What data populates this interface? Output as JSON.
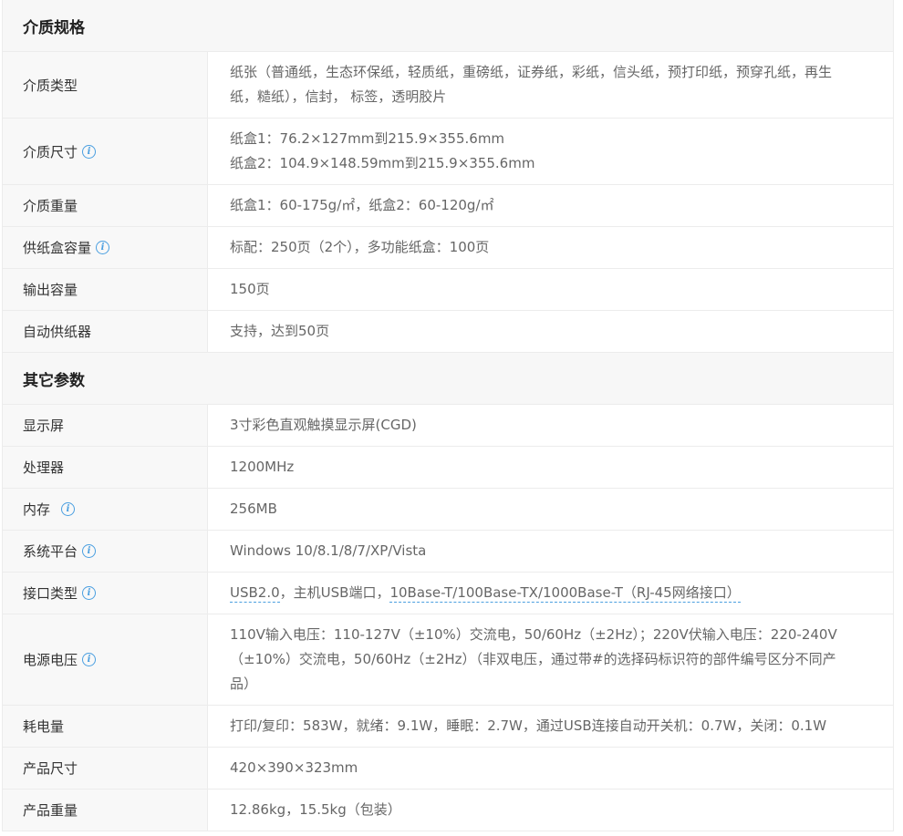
{
  "sections": [
    {
      "title": "介质规格",
      "rows": [
        {
          "label": "介质类型",
          "info": false,
          "lines": [
            "纸张（普通纸，生态环保纸，轻质纸，重磅纸，证券纸，彩纸，信头纸，预打印纸，预穿孔纸，再生",
            "纸，糙纸），信封， 标签，透明胶片"
          ]
        },
        {
          "label": "介质尺寸",
          "info": true,
          "lines": [
            "纸盒1：76.2×127mm到215.9×355.6mm",
            "纸盒2：104.9×148.59mm到215.9×355.6mm"
          ]
        },
        {
          "label": "介质重量",
          "info": false,
          "lines": [
            "纸盒1：60-175g/㎡，纸盒2：60-120g/㎡"
          ]
        },
        {
          "label": "供纸盒容量",
          "info": true,
          "lines": [
            "标配：250页（2个），多功能纸盒：100页"
          ]
        },
        {
          "label": "输出容量",
          "info": false,
          "lines": [
            "150页"
          ]
        },
        {
          "label": "自动供纸器",
          "info": false,
          "lines": [
            "支持，达到50页"
          ]
        }
      ]
    },
    {
      "title": "其它参数",
      "rows": [
        {
          "label": "显示屏",
          "info": false,
          "lines": [
            "3寸彩色直观触摸显示屏(CGD)"
          ]
        },
        {
          "label": "处理器",
          "info": false,
          "lines": [
            "1200MHz"
          ]
        },
        {
          "label": "内存",
          "info": true,
          "lines": [
            "256MB"
          ]
        },
        {
          "label": "系统平台",
          "info": true,
          "lines": [
            "Windows 10/8.1/8/7/XP/Vista"
          ]
        },
        {
          "label": "接口类型",
          "info": true,
          "interface": {
            "link1": "USB2.0",
            "mid": "，主机USB端口，",
            "link2": "10Base-T/100Base-TX/1000Base-T（RJ-45网络接口）"
          }
        },
        {
          "label": "电源电压",
          "info": true,
          "lines": [
            "110V输入电压：110-127V（±10%）交流电，50/60Hz（±2Hz）；220V伏输入电压：220-240V",
            "（±10%）交流电，50/60Hz（±2Hz）（非双电压，通过带#的选择码标识符的部件编号区分不同产",
            "品）"
          ]
        },
        {
          "label": "耗电量",
          "info": false,
          "lines": [
            "打印/复印：583W，就绪：9.1W，睡眠：2.7W，通过USB连接自动开关机：0.7W，关闭：0.1W"
          ]
        },
        {
          "label": "产品尺寸",
          "info": false,
          "lines": [
            "420×390×323mm"
          ]
        },
        {
          "label": "产品重量",
          "info": false,
          "lines": [
            "12.86kg，15.5kg（包装）"
          ]
        }
      ]
    }
  ],
  "info_glyph": "i"
}
